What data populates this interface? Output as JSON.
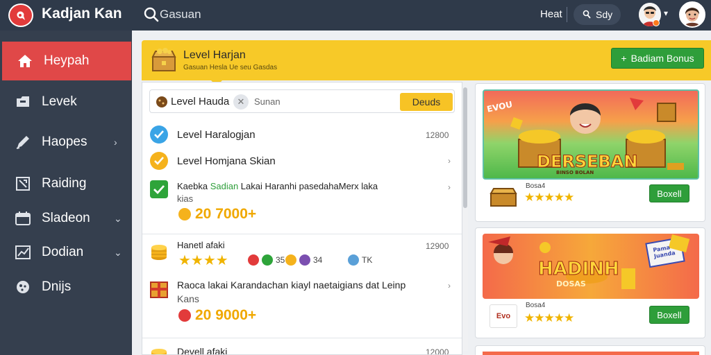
{
  "header": {
    "app_title": "Kadjan Kan",
    "search_placeholder": "Gasuan",
    "top_link": "Heat",
    "user_label": "Sdy"
  },
  "sidebar": {
    "items": [
      {
        "label": "Heypah",
        "icon": "home-icon",
        "active": true
      },
      {
        "label": "Levek",
        "icon": "inbox-icon"
      },
      {
        "label": "Haopes",
        "icon": "pen-icon",
        "chevron": true
      },
      {
        "label": "Raiding",
        "icon": "expand-icon"
      },
      {
        "label": "Sladeon",
        "icon": "calendar-icon",
        "chevron": true
      },
      {
        "label": "Dodian",
        "icon": "chart-icon",
        "chevron": true
      },
      {
        "label": "Dnijs",
        "icon": "settings-icon"
      }
    ]
  },
  "banner": {
    "title": "Level Harjan",
    "subtitle": "Gasuan Hesla Ue seu Gasdas",
    "bonus_label": "Badiam Bonus"
  },
  "filter": {
    "label": "Level Hauda",
    "search_text": "Sunan",
    "button_label": "Deuds"
  },
  "list": {
    "rows": [
      {
        "title": "Level Haralogjan",
        "right": "12800"
      },
      {
        "title": "Level Homjana Skian"
      },
      {
        "title": "Kaebka Sadian Lakai Haranhi pasedahaMerx laka",
        "title_highlight": "Sadian",
        "sub": "kias",
        "coins": "20 7000+"
      },
      {
        "title": "Hanetl afaki",
        "right": "12900",
        "stars": "★★★★",
        "meta": [
          "35",
          "34",
          "TK"
        ]
      },
      {
        "title": "Raoca lakai Karandachan kiayl naetaigians dat Leinp",
        "sub": "Kans",
        "coins": "20 9000+"
      },
      {
        "title": "Devell afaki",
        "right": "12000"
      }
    ]
  },
  "cards": [
    {
      "art_title": "DERSEBAN",
      "art_sub": "BINSO BOLAN",
      "art_tag": "EVOU",
      "meta": "Bosa4",
      "stars": "★★★★★",
      "button": "Boxell"
    },
    {
      "art_title": "HADINH",
      "art_sub": "DOSAS",
      "art_tag": "Pama Juanda",
      "meta": "Bosa4",
      "thumb_label": "Evo",
      "stars": "★★★★★",
      "button": "Boxell"
    }
  ],
  "colors": {
    "topbar": "#2f3a4a",
    "sidebar": "#353f4e",
    "active": "#e04848",
    "banner": "#f7c928",
    "green": "#2e9e3a"
  }
}
